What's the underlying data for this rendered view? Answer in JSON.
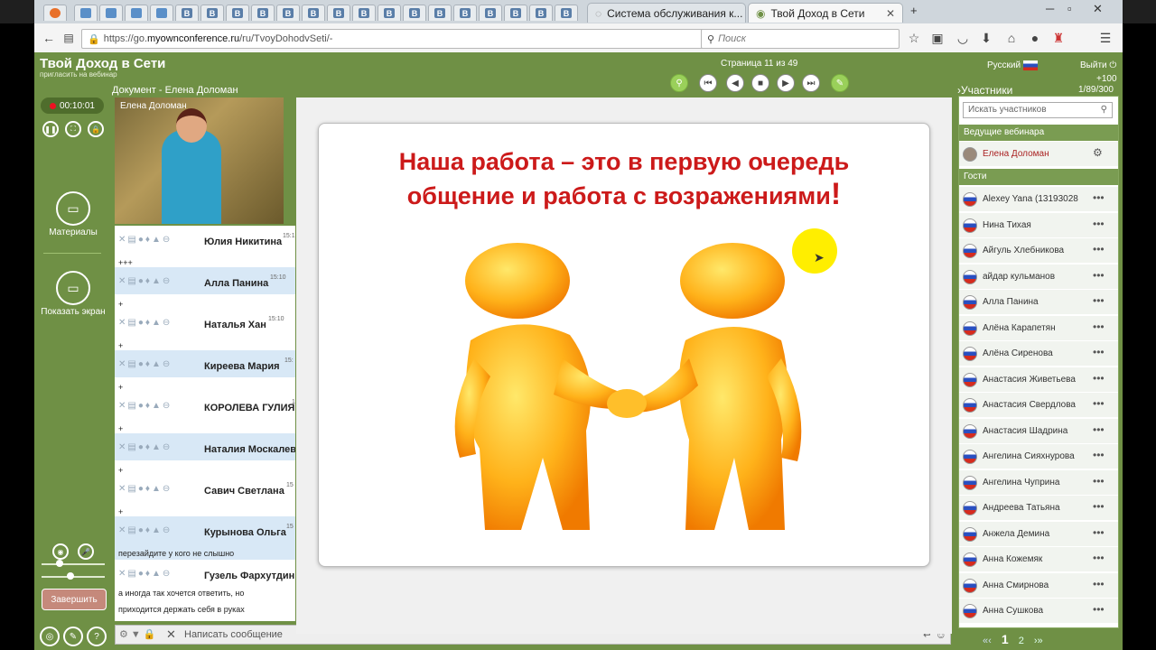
{
  "browser": {
    "tabs": [
      {
        "label": "Система обслуживания к...",
        "active": false
      },
      {
        "label": "Твой Доход в Сети",
        "active": true
      }
    ],
    "mini_tab_letter": "В",
    "url_prefix": "https://go.",
    "url_domain": "myownconference.ru",
    "url_path": "/ru/TvoyDohodvSeti/-",
    "search_placeholder": "Поиск"
  },
  "app": {
    "title": "Твой Доход в Сети",
    "subtitle": "пригласить на вебинар",
    "document_title": "Документ - Елена Доломан",
    "page_info": "Страница 11 из 49",
    "language": "Русский",
    "exit": "Выйти",
    "plus": "+100",
    "counter": "1/89/300",
    "participants_header": "Участники",
    "timer": "00:10:01",
    "materials_label": "Материалы",
    "show_screen_label": "Показать экран",
    "finish_label": "Завершить"
  },
  "video": {
    "name": "Елена Доломан"
  },
  "chat": {
    "entries": [
      {
        "name": "Юлия Никитина",
        "time": "15:1",
        "msg": "+++",
        "alt": false
      },
      {
        "name": "Алла Панина",
        "time": "15:10",
        "msg": "+",
        "alt": true
      },
      {
        "name": "Наталья Хан",
        "time": "15:10",
        "msg": "+",
        "alt": false
      },
      {
        "name": "Киреева Мария",
        "time": "15:",
        "msg": "+",
        "alt": true
      },
      {
        "name": "КОРОЛЕВА ГУЛИЯ",
        "time": "1",
        "msg": "+",
        "alt": false
      },
      {
        "name": "Наталия Москалев",
        "time": "",
        "msg": "+",
        "alt": true
      },
      {
        "name": "Савич Светлана",
        "time": "15",
        "msg": "+",
        "alt": false
      },
      {
        "name": "Курынова Ольга",
        "time": "15",
        "msg": "перезайдите у кого не слышно",
        "alt": true
      },
      {
        "name": "Гузель Фархутдин",
        "time": "",
        "msg": "а иногда так хочется ответить, но",
        "alt": false
      }
    ],
    "last_line": "приходится держать себя в руках",
    "input_placeholder": "Написать сообщение"
  },
  "slide": {
    "line1": "Наша работа – это в первую очередь",
    "line2": "общение и работа с возражениями",
    "exclaim": "!"
  },
  "participants": {
    "search_placeholder": "Искать участников",
    "hosts_header": "Ведущие вебинара",
    "host": "Елена Доломан",
    "guests_header": "Гости",
    "guests": [
      "Alexey Yana (13193028",
      "Нина Тихая",
      "Айгуль Хлебникова",
      "айдар кульманов",
      "Алла Панина",
      "Алёна Карапетян",
      "Алёна Сиренова",
      "Анастасия Живетьева",
      "Анастасия Свердлова",
      "Анастасия Шадрина",
      "Ангелина Сияхнурова",
      "Ангелина Чуприна",
      "Андреева Татьяна",
      "Анжела Демина",
      "Анна Кожемяк",
      "Анна Смирнова",
      "Анна Сушкова"
    ],
    "pager": {
      "prev": "«‹",
      "page1": "1",
      "page2": "2",
      "next": "›»"
    }
  },
  "colors": {
    "app_green": "#6f9045",
    "slide_title": "#cc1a1a",
    "panel_header": "#7a9c52"
  }
}
